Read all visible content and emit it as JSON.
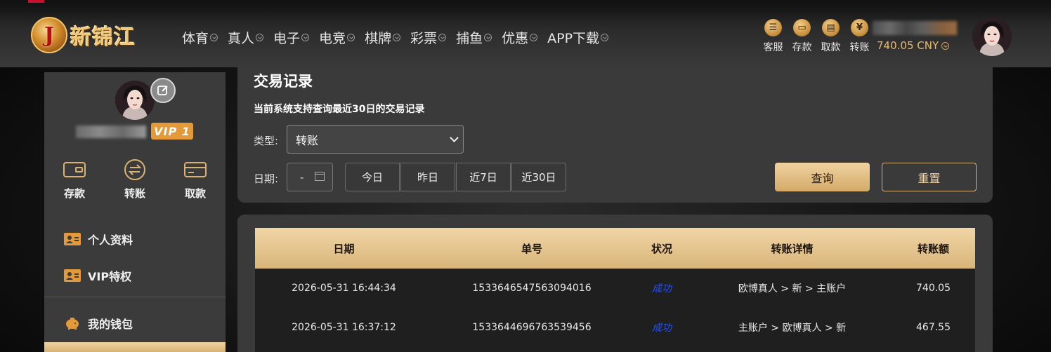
{
  "header": {
    "logo_letter": "J",
    "logo_text": "新锦江",
    "nav": [
      "体育",
      "真人",
      "电子",
      "电竞",
      "棋牌",
      "彩票",
      "捕鱼",
      "优惠",
      "APP下载"
    ],
    "actions": [
      {
        "label": "客服",
        "icon": "service-icon"
      },
      {
        "label": "存款",
        "icon": "deposit-icon"
      },
      {
        "label": "取款",
        "icon": "withdraw-icon"
      },
      {
        "label": "转账",
        "icon": "transfer-icon"
      }
    ],
    "balance": "740.05 CNY"
  },
  "sidebar": {
    "vip": "VIP 1",
    "quick": [
      {
        "label": "存款",
        "icon": "wallet-card-icon"
      },
      {
        "label": "转账",
        "icon": "transfer-circle-icon"
      },
      {
        "label": "取款",
        "icon": "card-icon"
      }
    ],
    "menu": [
      {
        "label": "个人资料",
        "icon": "profile-card-icon"
      },
      {
        "label": "VIP特权",
        "icon": "vip-card-icon"
      }
    ],
    "wallet_label": "我的钱包"
  },
  "filter": {
    "title": "交易记录",
    "subtitle": "当前系统支持查询最近30日的交易记录",
    "type_label": "类型:",
    "type_value": "转账",
    "date_label": "日期:",
    "date_value": "-",
    "quick_dates": [
      "今日",
      "昨日",
      "近7日",
      "近30日"
    ],
    "query_label": "查询",
    "reset_label": "重置"
  },
  "table": {
    "headers": [
      "日期",
      "单号",
      "状况",
      "转账详情",
      "转账额"
    ],
    "rows": [
      [
        "2026-05-31 16:44:34",
        "1533646547563094016",
        "成功",
        "欧博真人 > 新 > 主账户",
        "740.05"
      ],
      [
        "2026-05-31 16:37:12",
        "1533644696763539456",
        "成功",
        "主账户 > 欧博真人 > 新",
        "467.55"
      ]
    ]
  },
  "colors": {
    "accent_gold": "#d8b47a",
    "status_success": "#2250ff",
    "panel_bg": "#3a3a3a"
  }
}
